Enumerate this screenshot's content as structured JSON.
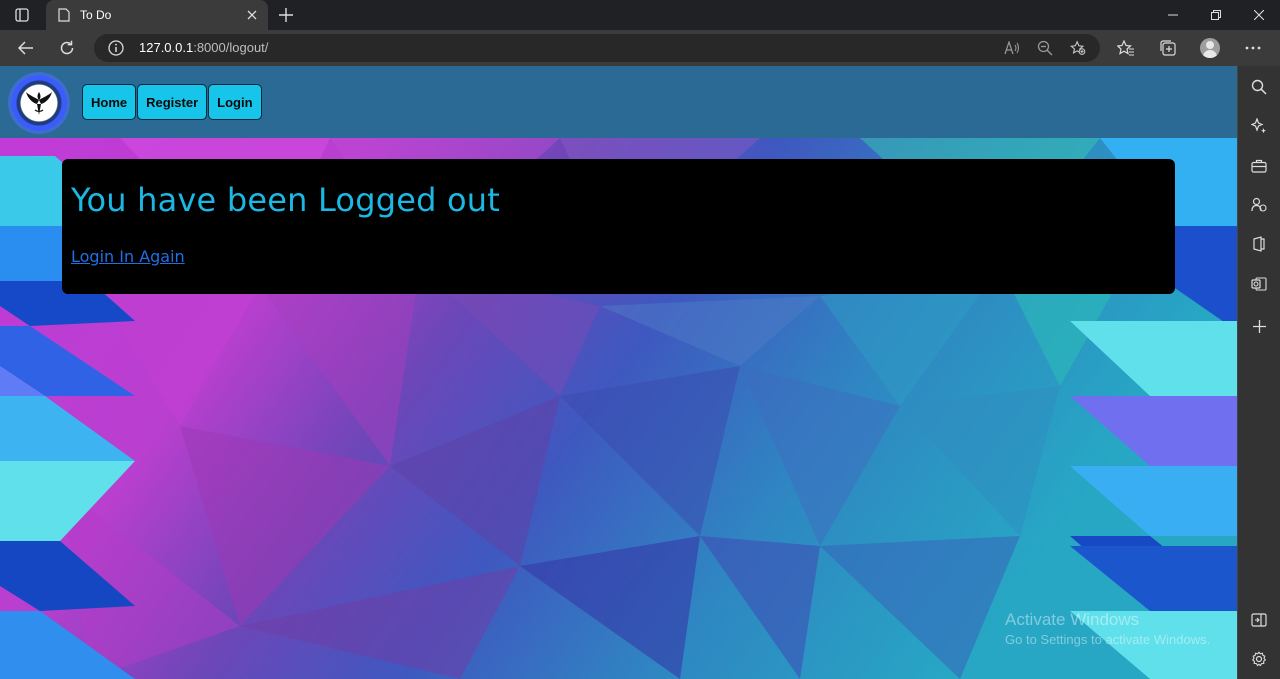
{
  "browser": {
    "tab_title": "To Do",
    "url_host": "127.0.0.1",
    "url_rest": ":8000/logout/"
  },
  "site": {
    "nav": [
      {
        "label": "Home"
      },
      {
        "label": "Register"
      },
      {
        "label": "Login"
      }
    ]
  },
  "content": {
    "heading": "You have been Logged out",
    "link_label": "Login In Again"
  },
  "watermark": {
    "line1": "Activate Windows",
    "line2": "Go to Settings to activate Windows."
  },
  "colors": {
    "navbar": "#2a6a95",
    "nav_button": "#17c4ea",
    "heading": "#1bb8e4",
    "link": "#1f6fe6",
    "card": "#000000"
  }
}
